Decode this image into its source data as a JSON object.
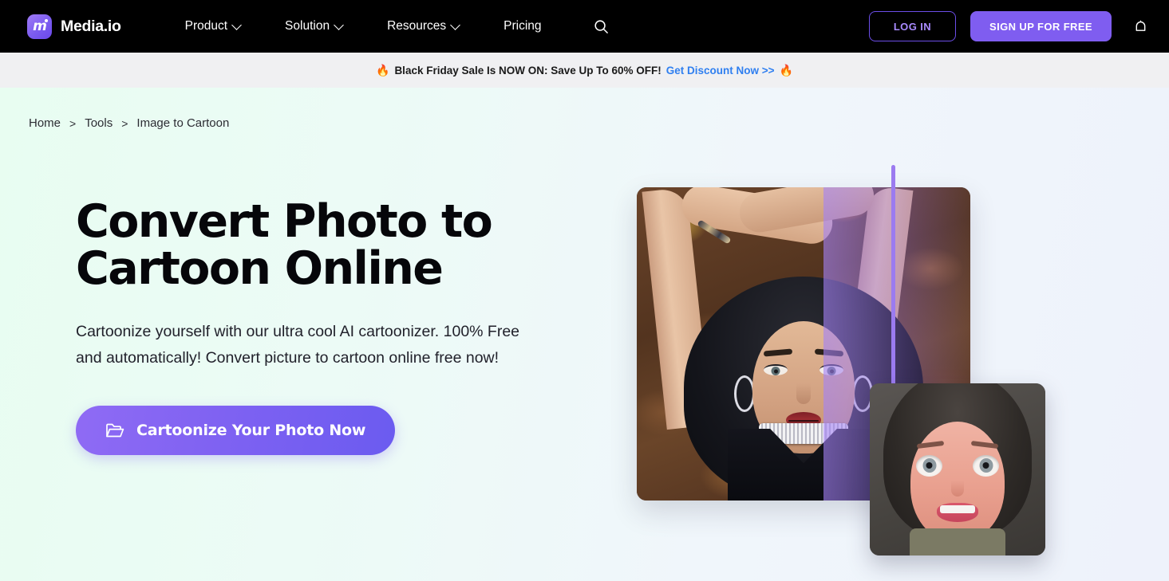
{
  "header": {
    "brand": {
      "name": "Media.io",
      "logo_icon": "media-io-logo-icon"
    },
    "nav": [
      {
        "label": "Product",
        "has_dropdown": true
      },
      {
        "label": "Solution",
        "has_dropdown": true
      },
      {
        "label": "Resources",
        "has_dropdown": true
      },
      {
        "label": "Pricing",
        "has_dropdown": false
      }
    ],
    "search_icon": "search-icon",
    "login_label": "LOG IN",
    "signup_label": "SIGN UP FOR FREE",
    "bell_icon": "notification-bell-icon",
    "colors": {
      "background": "#000000",
      "accent_purple": "#7f5df0",
      "login_text": "#a98bff"
    }
  },
  "banner": {
    "emoji_left": "🔥",
    "emoji_right": "🔥",
    "text": "Black Friday Sale Is NOW ON: Save Up To 60% OFF!",
    "link_label": "Get Discount Now >>",
    "background": "#f0f0f2",
    "link_color": "#2f7ff0"
  },
  "breadcrumb": {
    "items": [
      {
        "label": "Home"
      },
      {
        "label": "Tools"
      },
      {
        "label": "Image to Cartoon"
      }
    ],
    "separator": ">"
  },
  "hero": {
    "title_line1": "Convert Photo to",
    "title_line2": "Cartoon Online",
    "subtitle": "Cartoonize yourself with our ultra cool AI cartoonizer. 100% Free and automatically! Convert picture to cartoon online free now!",
    "cta_label": "Cartoonize Your Photo Now",
    "cta_icon": "folder-open-icon",
    "background_left": "#e8fdf1",
    "background_right": "#eef2fb",
    "cta_gradient_from": "#8f6bf4",
    "cta_gradient_to": "#6b5bf0"
  },
  "hero_media": {
    "comparison_divider_color": "#9b7bf0",
    "before_image_alt": "Woman lying on autumn leaves original photo",
    "after_image_alt": "Cartoonized 3D portrait result"
  }
}
